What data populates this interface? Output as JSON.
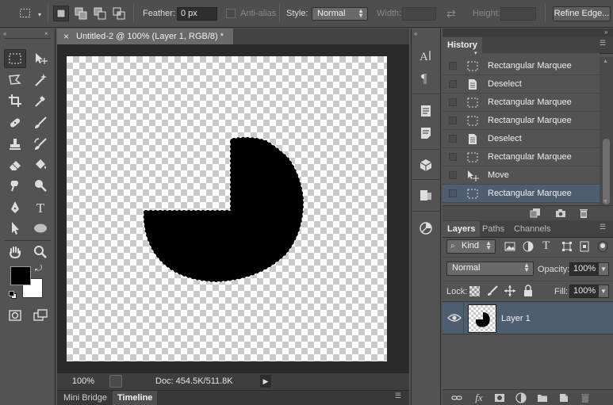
{
  "options_bar": {
    "feather_label": "Feather:",
    "feather_value": "0 px",
    "antialias_label": "Anti-alias",
    "style_label": "Style:",
    "style_value": "Normal",
    "width_label": "Width:",
    "height_label": "Height:",
    "refine_edge_label": "Refine Edge..."
  },
  "document": {
    "tab_title": "Untitled-2 @ 100% (Layer 1, RGB/8) *",
    "zoom": "100%",
    "doc_size": "Doc: 454.5K/511.8K"
  },
  "bottom_tabs": [
    "Mini Bridge",
    "Timeline"
  ],
  "history": {
    "title": "History",
    "items": [
      {
        "label": "Rectangular Marquee",
        "icon": "marquee-icon"
      },
      {
        "label": "Deselect",
        "icon": "document-icon"
      },
      {
        "label": "Rectangular Marquee",
        "icon": "marquee-icon"
      },
      {
        "label": "Rectangular Marquee",
        "icon": "marquee-icon"
      },
      {
        "label": "Deselect",
        "icon": "document-icon"
      },
      {
        "label": "Rectangular Marquee",
        "icon": "marquee-icon"
      },
      {
        "label": "Move",
        "icon": "move-icon"
      },
      {
        "label": "Rectangular Marquee",
        "icon": "marquee-icon",
        "active": true
      }
    ]
  },
  "layers_panel": {
    "tabs": [
      "Layers",
      "Paths",
      "Channels"
    ],
    "filter_label": "Kind",
    "blend_mode": "Normal",
    "opacity_label": "Opacity:",
    "opacity_value": "100%",
    "lock_label": "Lock:",
    "fill_label": "Fill:",
    "fill_value": "100%",
    "layers": [
      {
        "name": "Layer 1",
        "visible": true,
        "selected": true
      }
    ]
  },
  "colors": {
    "foreground": "#000000",
    "background": "#ffffff",
    "selection_highlight": "#4f5d70"
  }
}
